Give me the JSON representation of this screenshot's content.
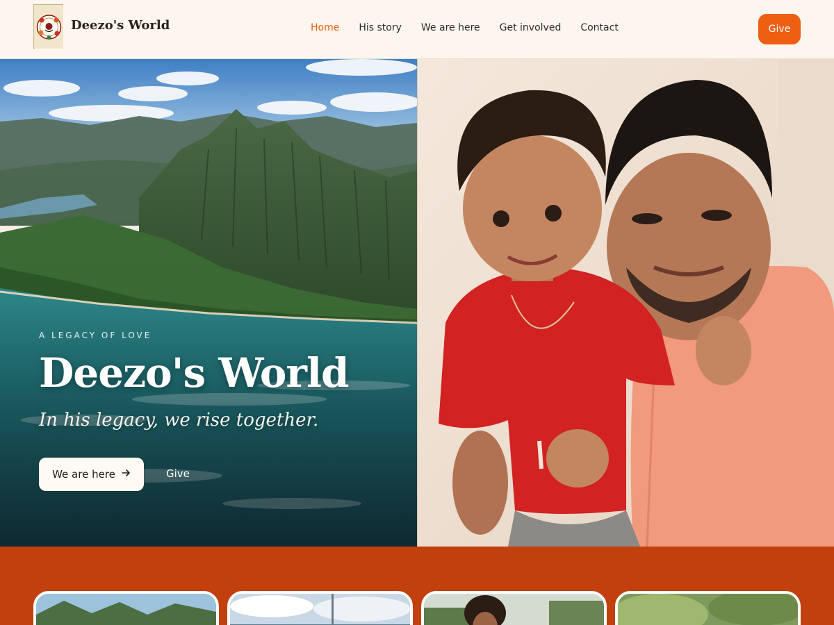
{
  "header": {
    "brand_name": "Deezo's World",
    "nav": [
      {
        "label": "Home",
        "active": true
      },
      {
        "label": "His story",
        "active": false
      },
      {
        "label": "We are here",
        "active": false
      },
      {
        "label": "Get involved",
        "active": false
      },
      {
        "label": "Contact",
        "active": false
      }
    ],
    "give_label": "Give"
  },
  "hero": {
    "eyebrow": "A LEGACY OF LOVE",
    "title": "Deezo's World",
    "tagline": "In his legacy, we rise together.",
    "primary_button": "We are here",
    "primary_button_icon": "arrow-right-icon",
    "secondary_button": "Give"
  },
  "colors": {
    "accent": "#ee5f12",
    "nav_active": "#e8610e",
    "band": "#c2400e",
    "page_bg": "#fdf6ee"
  },
  "cards_count_visible": 4
}
